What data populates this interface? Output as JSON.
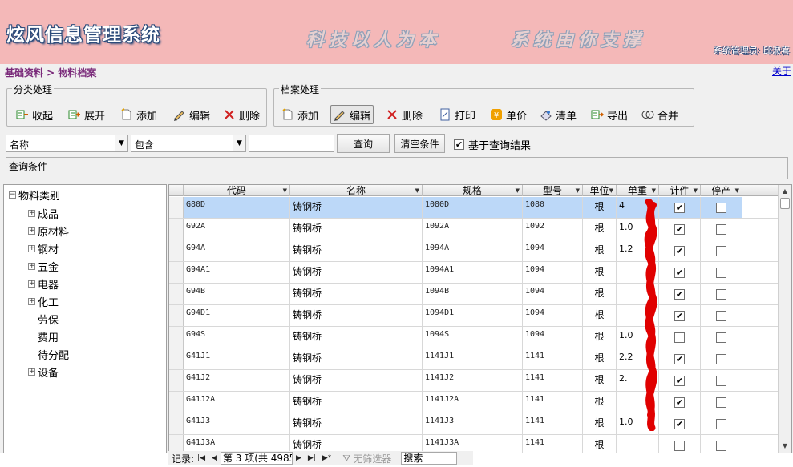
{
  "header": {
    "app_title": "炫风信息管理系统",
    "slogan_left": "科技以人为本",
    "slogan_right": "系统由你支撑",
    "admin_label": "系统管理员: 邱淑喜"
  },
  "breadcrumb": "基础资料 > 物料档案",
  "about_link": "关于",
  "category_group": {
    "title": "分类处理",
    "buttons": [
      "收起",
      "展开",
      "添加",
      "编辑",
      "删除"
    ]
  },
  "archive_group": {
    "title": "档案处理",
    "buttons": [
      "添加",
      "编辑",
      "删除",
      "打印",
      "单价",
      "清单",
      "导出",
      "合并"
    ]
  },
  "query": {
    "field": "名称",
    "operator": "包含",
    "value": "",
    "query_button": "查询",
    "clear_button": "清空条件",
    "based_on_results_label": "基于查询结果",
    "based_on_results_checked": true,
    "conditions_label": "查询条件"
  },
  "tree": {
    "root": "物料类别",
    "items": [
      {
        "label": "成品",
        "expandable": true
      },
      {
        "label": "原材料",
        "expandable": true
      },
      {
        "label": "钢材",
        "expandable": true
      },
      {
        "label": "五金",
        "expandable": true
      },
      {
        "label": "电器",
        "expandable": true
      },
      {
        "label": "化工",
        "expandable": true
      },
      {
        "label": "劳保",
        "expandable": false
      },
      {
        "label": "费用",
        "expandable": false
      },
      {
        "label": "待分配",
        "expandable": false
      },
      {
        "label": "设备",
        "expandable": true
      }
    ]
  },
  "grid": {
    "columns": [
      "代码",
      "名称",
      "规格",
      "型号",
      "单位",
      "单重",
      "计件",
      "停产"
    ],
    "rows": [
      {
        "code": "G80D",
        "name": "铸钢桥",
        "spec": "1080D",
        "model": "1080",
        "unit": "根",
        "weight": "4",
        "piece": true,
        "stopped": false
      },
      {
        "code": "G92A",
        "name": "铸钢桥",
        "spec": "1092A",
        "model": "1092",
        "unit": "根",
        "weight": "1.0",
        "piece": true,
        "stopped": false
      },
      {
        "code": "G94A",
        "name": "铸钢桥",
        "spec": "1094A",
        "model": "1094",
        "unit": "根",
        "weight": "1.2",
        "piece": true,
        "stopped": false
      },
      {
        "code": "G94A1",
        "name": "铸钢桥",
        "spec": "1094A1",
        "model": "1094",
        "unit": "根",
        "weight": "",
        "piece": true,
        "stopped": false
      },
      {
        "code": "G94B",
        "name": "铸钢桥",
        "spec": "1094B",
        "model": "1094",
        "unit": "根",
        "weight": "",
        "piece": true,
        "stopped": false
      },
      {
        "code": "G94D1",
        "name": "铸钢桥",
        "spec": "1094D1",
        "model": "1094",
        "unit": "根",
        "weight": "",
        "piece": true,
        "stopped": false
      },
      {
        "code": "G94S",
        "name": "铸钢桥",
        "spec": "1094S",
        "model": "1094",
        "unit": "根",
        "weight": "1.0",
        "piece": false,
        "stopped": false
      },
      {
        "code": "G41J1",
        "name": "铸钢桥",
        "spec": "1141J1",
        "model": "1141",
        "unit": "根",
        "weight": "2.2",
        "piece": true,
        "stopped": false
      },
      {
        "code": "G41J2",
        "name": "铸钢桥",
        "spec": "1141J2",
        "model": "1141",
        "unit": "根",
        "weight": "2.",
        "piece": true,
        "stopped": false
      },
      {
        "code": "G41J2A",
        "name": "铸钢桥",
        "spec": "1141J2A",
        "model": "1141",
        "unit": "根",
        "weight": "",
        "piece": true,
        "stopped": false
      },
      {
        "code": "G41J3",
        "name": "铸钢桥",
        "spec": "1141J3",
        "model": "1141",
        "unit": "根",
        "weight": "1.0",
        "piece": true,
        "stopped": false
      },
      {
        "code": "G41J3A",
        "name": "铸钢桥",
        "spec": "1141J3A",
        "model": "1141",
        "unit": "根",
        "weight": "",
        "piece": false,
        "stopped": false
      }
    ]
  },
  "navigator": {
    "record_label": "记录:",
    "position_text": "第 3 项(共 4985",
    "filter_label": "无筛选器",
    "search_label": "搜索"
  },
  "colors": {
    "banner": "#f4b8b8",
    "breadcrumb": "#7a2a7a",
    "selected_row": "#bcd8f8",
    "redaction": "#e00000"
  }
}
